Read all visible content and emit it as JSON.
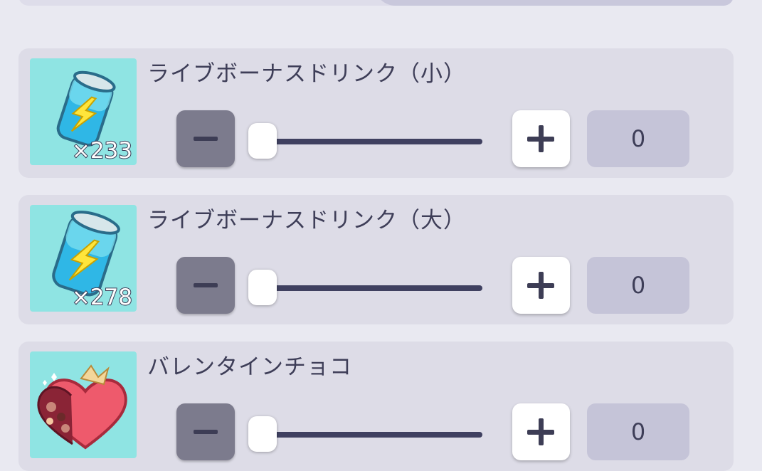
{
  "items": [
    {
      "name": "ライブボーナスドリンク（小）",
      "count": "×233",
      "icon": "energy-drink-can-icon",
      "quantity": "0",
      "slider_fraction": 0
    },
    {
      "name": "ライブボーナスドリンク（大）",
      "count": "×278",
      "icon": "energy-drink-can-icon",
      "quantity": "0",
      "slider_fraction": 0
    },
    {
      "name": "バレンタインチョコ",
      "count": "",
      "icon": "heart-chocolate-box-icon",
      "quantity": "0",
      "slider_fraction": 0
    }
  ],
  "colors": {
    "background": "#e9e9f1",
    "card": "#dddce7",
    "icon_background": "#8fe4e3",
    "minus_button": "#7c7b8d",
    "quantity_field": "#c5c4d8",
    "text": "#3e3e58"
  }
}
